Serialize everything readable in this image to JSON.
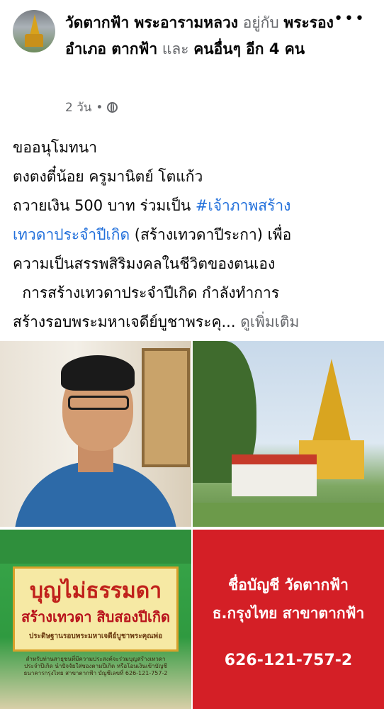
{
  "post": {
    "author_name": "วัดตากฟ้า พระอารามหลวง",
    "with_word": "อยู่กับ",
    "tagged_person": "พระรองอำเภอ ตากฟ้า",
    "and_word": "และ",
    "others": "คนอื่นๆ อีก 4 คน",
    "time": "2 วัน",
    "separator": "•",
    "privacy_icon": "globe-icon",
    "more_icon": "more-horizontal-icon",
    "more_glyph": "•••"
  },
  "text": {
    "line1": "ขออนุโมทนา",
    "line2": "ตงตงตี๋น้อย ครูมานิตย์ โตแก้ว",
    "line3_plain": "ถวายเงิน 500 บาท ร่วมเป็น ",
    "hashtag_part1": "#เจ้าภาพสร้าง",
    "hashtag_part2": "เทวดาประจำปีเกิด",
    "line4_plain": " (สร้างเทวดาปีระกา) เพื่อ",
    "line5": "ความเป็นสรรพสิริมงคลในชีวิตของตนเอง",
    "line6": "  การสร้างเทวดาประจำปีเกิด กำลังทำการ",
    "line7": "สร้างรอบพระมหาเจดีย์บูชาพระคุ... ",
    "see_more": "ดูเพิ่มเติม"
  },
  "poster": {
    "headline": "บุญไม่ธรรมดา",
    "subhead": "สร้างเทวดา สิบสองปีเกิด",
    "caption": "ประดิษฐานรอบพระมหาเจดีย์บูชาพระคุณพ่อ",
    "fine_print": "สำหรับท่านสาธุชนที่มีความประสงค์จะร่วมบุญสร้างเทวดาประจำปีเกิด นำปัจจัยใส่ซองตามปีเกิด หรือโอนเงินเข้าบัญชี ธนาคารกรุงไทย สาขาตากฟ้า บัญชีเลขที่ 626-121-757-2"
  },
  "account_card": {
    "line1": "ชื่อบัญชี วัดตากฟ้า",
    "line2": "ธ.กรุงไทย สาขาตากฟ้า",
    "number": "626-121-757-2",
    "bg_color": "#d41f26"
  },
  "colors": {
    "link": "#216fdb",
    "muted": "#65676b"
  }
}
